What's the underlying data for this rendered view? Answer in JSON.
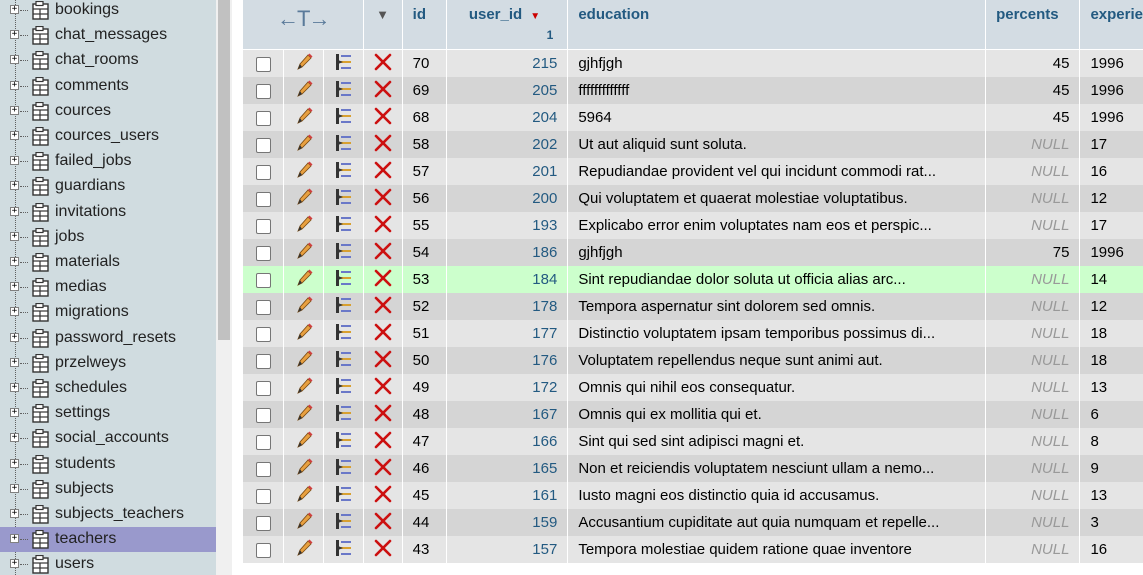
{
  "sidebar": {
    "items": [
      {
        "label": "bookings",
        "active": false
      },
      {
        "label": "chat_messages",
        "active": false
      },
      {
        "label": "chat_rooms",
        "active": false
      },
      {
        "label": "comments",
        "active": false
      },
      {
        "label": "cources",
        "active": false
      },
      {
        "label": "cources_users",
        "active": false
      },
      {
        "label": "failed_jobs",
        "active": false
      },
      {
        "label": "guardians",
        "active": false
      },
      {
        "label": "invitations",
        "active": false
      },
      {
        "label": "jobs",
        "active": false
      },
      {
        "label": "materials",
        "active": false
      },
      {
        "label": "medias",
        "active": false
      },
      {
        "label": "migrations",
        "active": false
      },
      {
        "label": "password_resets",
        "active": false
      },
      {
        "label": "przelweys",
        "active": false
      },
      {
        "label": "schedules",
        "active": false
      },
      {
        "label": "settings",
        "active": false
      },
      {
        "label": "social_accounts",
        "active": false
      },
      {
        "label": "students",
        "active": false
      },
      {
        "label": "subjects",
        "active": false
      },
      {
        "label": "subjects_teachers",
        "active": false
      },
      {
        "label": "teachers",
        "active": true
      },
      {
        "label": "users",
        "active": false
      }
    ],
    "expander_symbol": "+"
  },
  "table": {
    "header_arrows": "←T→",
    "header_menu": "▼",
    "sort_arrow": "▼",
    "sort_order": "1",
    "columns": [
      "id",
      "user_id",
      "education",
      "percents",
      "experience"
    ],
    "rows": [
      {
        "id": "70",
        "user_id": "215",
        "education": "gjhfjgh",
        "percents": "45",
        "experience": "1996",
        "highlight": false
      },
      {
        "id": "69",
        "user_id": "205",
        "education": "fffffffffffff",
        "percents": "45",
        "experience": "1996",
        "highlight": false
      },
      {
        "id": "68",
        "user_id": "204",
        "education": "5964",
        "percents": "45",
        "experience": "1996",
        "highlight": false
      },
      {
        "id": "58",
        "user_id": "202",
        "education": "Ut aut aliquid sunt soluta.",
        "percents": "NULL",
        "experience": "17",
        "highlight": false
      },
      {
        "id": "57",
        "user_id": "201",
        "education": "Repudiandae provident vel qui incidunt commodi rat...",
        "percents": "NULL",
        "experience": "16",
        "highlight": false
      },
      {
        "id": "56",
        "user_id": "200",
        "education": "Qui voluptatem et quaerat molestiae voluptatibus.",
        "percents": "NULL",
        "experience": "12",
        "highlight": false
      },
      {
        "id": "55",
        "user_id": "193",
        "education": "Explicabo error enim voluptates nam eos et perspic...",
        "percents": "NULL",
        "experience": "17",
        "highlight": false
      },
      {
        "id": "54",
        "user_id": "186",
        "education": "gjhfjgh",
        "percents": "75",
        "experience": "1996",
        "highlight": false
      },
      {
        "id": "53",
        "user_id": "184",
        "education": "Sint repudiandae dolor soluta ut officia alias arc...",
        "percents": "NULL",
        "experience": "14",
        "highlight": true
      },
      {
        "id": "52",
        "user_id": "178",
        "education": "Tempora aspernatur sint dolorem sed omnis.",
        "percents": "NULL",
        "experience": "12",
        "highlight": false
      },
      {
        "id": "51",
        "user_id": "177",
        "education": "Distinctio voluptatem ipsam temporibus possimus di...",
        "percents": "NULL",
        "experience": "18",
        "highlight": false
      },
      {
        "id": "50",
        "user_id": "176",
        "education": "Voluptatem repellendus neque sunt animi aut.",
        "percents": "NULL",
        "experience": "18",
        "highlight": false
      },
      {
        "id": "49",
        "user_id": "172",
        "education": "Omnis qui nihil eos consequatur.",
        "percents": "NULL",
        "experience": "13",
        "highlight": false
      },
      {
        "id": "48",
        "user_id": "167",
        "education": "Omnis qui ex mollitia qui et.",
        "percents": "NULL",
        "experience": "6",
        "highlight": false
      },
      {
        "id": "47",
        "user_id": "166",
        "education": "Sint qui sed sint adipisci magni et.",
        "percents": "NULL",
        "experience": "8",
        "highlight": false
      },
      {
        "id": "46",
        "user_id": "165",
        "education": "Non et reiciendis voluptatem nesciunt ullam a nemo...",
        "percents": "NULL",
        "experience": "9",
        "highlight": false
      },
      {
        "id": "45",
        "user_id": "161",
        "education": "Iusto magni eos distinctio quia id accusamus.",
        "percents": "NULL",
        "experience": "13",
        "highlight": false
      },
      {
        "id": "44",
        "user_id": "159",
        "education": "Accusantium cupiditate aut quia numquam et repelle...",
        "percents": "NULL",
        "experience": "3",
        "highlight": false
      },
      {
        "id": "43",
        "user_id": "157",
        "education": "Tempora molestiae quidem ratione quae inventore",
        "percents": "NULL",
        "experience": "16",
        "highlight": false
      }
    ]
  },
  "icons": {
    "edit": "pencil-icon",
    "copy": "copy-row-icon",
    "delete": "delete-x-icon",
    "table": "table-icon"
  },
  "colors": {
    "sidebar_bg": "#d0dce0",
    "active_item": "#9999cc",
    "header_bg": "#d3dce3",
    "header_text": "#235a81",
    "row_odd": "#e5e5e5",
    "row_even": "#d5d5d5",
    "row_highlight": "#ccffcc",
    "null_text": "#999999",
    "delete_red": "#cc0000"
  }
}
